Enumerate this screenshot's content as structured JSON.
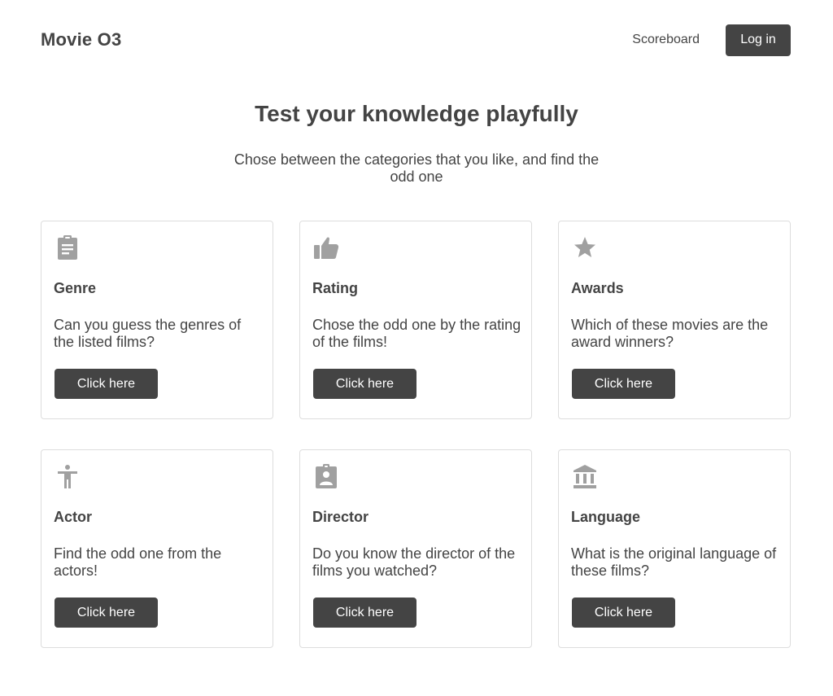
{
  "header": {
    "brand": "Movie O3",
    "nav_scoreboard": "Scoreboard",
    "login_label": "Log in"
  },
  "hero": {
    "title": "Test your knowledge playfully",
    "subtitle": "Chose between the categories that you like, and find the odd one"
  },
  "colors": {
    "text": "#444444",
    "button_bg": "#444444",
    "icon": "#a0a0a0",
    "card_border": "#dddddd"
  },
  "cards": [
    {
      "icon": "clipboard-icon",
      "title": "Genre",
      "text": "Can you guess the genres of the listed films?",
      "button": "Click here"
    },
    {
      "icon": "thumbs-up-icon",
      "title": "Rating",
      "text": "Chose the odd one by the rating of the films!",
      "button": "Click here"
    },
    {
      "icon": "star-icon",
      "title": "Awards",
      "text": "Which of these movies are the award winners?",
      "button": "Click here"
    },
    {
      "icon": "accessibility-person-icon",
      "title": "Actor",
      "text": "Find the odd one from the actors!",
      "button": "Click here"
    },
    {
      "icon": "contact-badge-icon",
      "title": "Director",
      "text": "Do you know the director of the films you watched?",
      "button": "Click here"
    },
    {
      "icon": "bank-building-icon",
      "title": "Language",
      "text": "What is the original language of these films?",
      "button": "Click here"
    }
  ]
}
